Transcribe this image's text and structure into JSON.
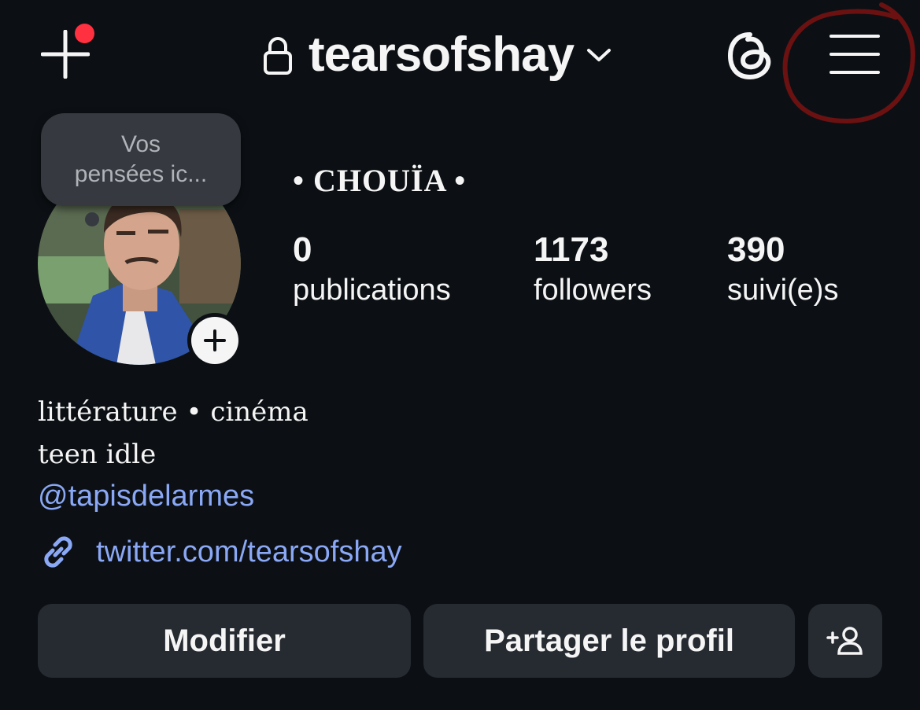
{
  "header": {
    "username": "tearsofshay",
    "icons": [
      "plus-icon",
      "lock-icon",
      "chevron-down-icon",
      "threads-icon",
      "hamburger-menu-icon"
    ],
    "notification_dot_color": "#ff3040"
  },
  "note": {
    "line1": "Vos",
    "line2": "pensées ic..."
  },
  "profile": {
    "display_name": "• CHOUÏA •",
    "stats": [
      {
        "value": "0",
        "label": "publications"
      },
      {
        "value": "1173",
        "label": "followers"
      },
      {
        "value": "390",
        "label": "suivi(e)s"
      }
    ],
    "bio": {
      "line1": "littérature • cinéma",
      "line2": "teen idle",
      "mention": "@tapisdelarmes",
      "link": "twitter.com/tearsofshay"
    }
  },
  "actions": {
    "edit_label": "Modifier",
    "share_label": "Partager le profil"
  },
  "colors": {
    "background": "#0c1014",
    "link": "#8aa8f5",
    "button_bg": "#262a31",
    "annotation": "#6b1111"
  }
}
